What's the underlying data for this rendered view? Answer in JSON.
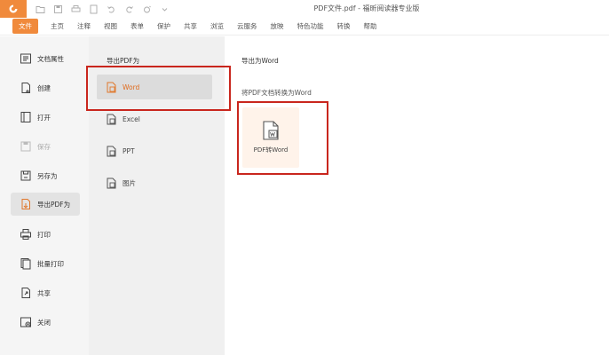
{
  "window": {
    "title": "PDF文件.pdf - 福昕阅读器专业版"
  },
  "menu": [
    "文件",
    "主页",
    "注释",
    "视图",
    "表单",
    "保护",
    "共享",
    "浏览",
    "云服务",
    "放映",
    "特色功能",
    "转换",
    "帮助"
  ],
  "sidebar": {
    "items": [
      {
        "label": "文档属性",
        "icon": "doc-properties-icon"
      },
      {
        "label": "创建",
        "icon": "create-icon"
      },
      {
        "label": "打开",
        "icon": "open-icon"
      },
      {
        "label": "保存",
        "icon": "save-icon"
      },
      {
        "label": "另存为",
        "icon": "save-as-icon"
      },
      {
        "label": "导出PDF为",
        "icon": "export-icon"
      },
      {
        "label": "打印",
        "icon": "print-icon"
      },
      {
        "label": "批量打印",
        "icon": "batch-print-icon"
      },
      {
        "label": "共享",
        "icon": "share-icon"
      },
      {
        "label": "关闭",
        "icon": "close-icon"
      }
    ]
  },
  "export_panel": {
    "title": "导出PDF为",
    "items": [
      {
        "label": "Word",
        "icon": "word-file-icon"
      },
      {
        "label": "Excel",
        "icon": "excel-file-icon"
      },
      {
        "label": "PPT",
        "icon": "ppt-file-icon"
      },
      {
        "label": "图片",
        "icon": "image-file-icon"
      }
    ]
  },
  "content": {
    "title": "导出为Word",
    "subtitle": "将PDF文档转换为Word",
    "card_label": "PDF转Word"
  },
  "colors": {
    "accent": "#f08a3c",
    "highlight": "#c9261d"
  }
}
